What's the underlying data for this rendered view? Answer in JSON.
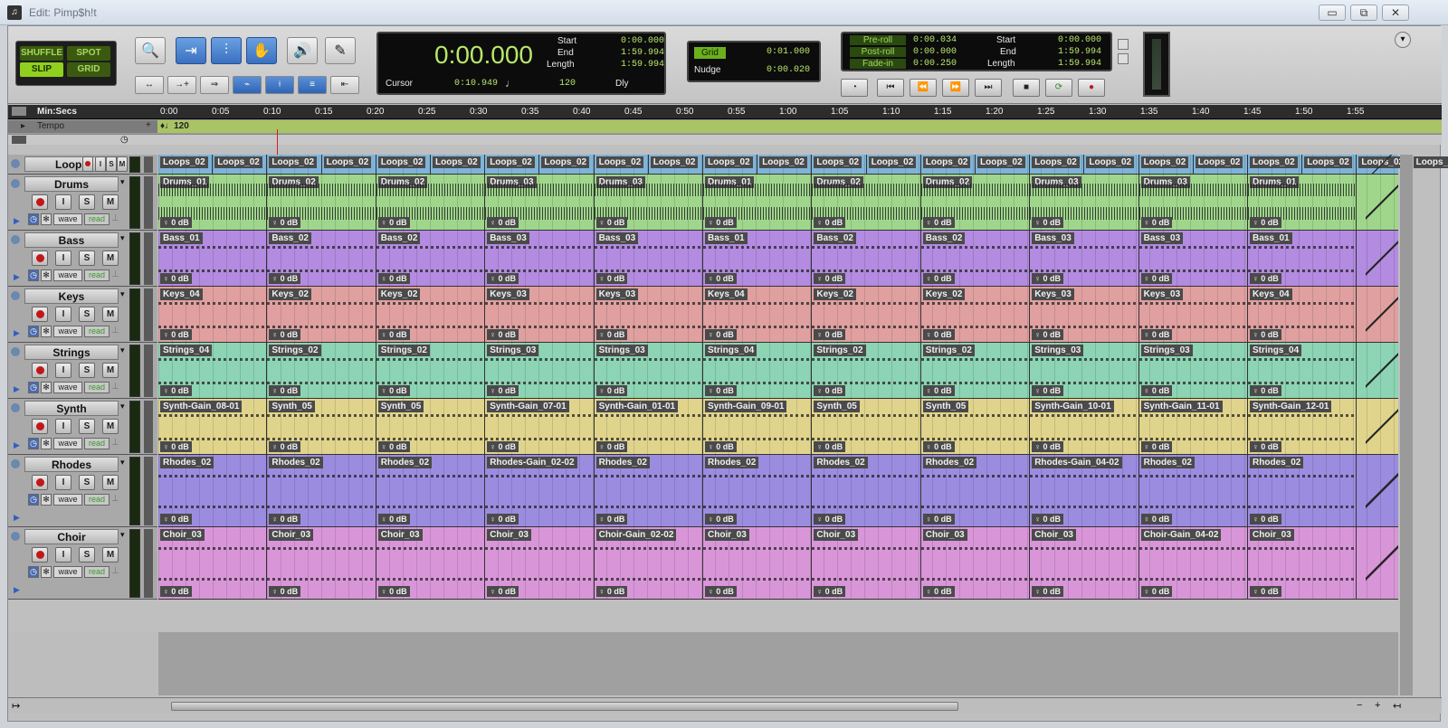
{
  "window": {
    "title": "Edit: Pimp$h!t",
    "buttons": [
      "▭",
      "⧉",
      "✕"
    ]
  },
  "modes": {
    "shuffle": "SHUFFLE",
    "spot": "SPOT",
    "slip": "SLIP",
    "grid": "GRID"
  },
  "main_counter": {
    "value": "0:00.000",
    "start_label": "Start",
    "end_label": "End",
    "length_label": "Length",
    "start": "0:00.000",
    "end": "1:59.994",
    "length": "1:59.994",
    "cursor_label": "Cursor",
    "cursor": "0:10.949",
    "tempo": "120",
    "dly_label": "Dly"
  },
  "grid": {
    "grid_label": "Grid",
    "grid_value": "0:01.000",
    "nudge_label": "Nudge",
    "nudge_value": "0:00.020"
  },
  "transport_counter": {
    "preroll_label": "Pre-roll",
    "postroll_label": "Post-roll",
    "fadein_label": "Fade-in",
    "preroll": "0:00.034",
    "postroll": "0:00.000",
    "fadein": "0:00.250",
    "start_label": "Start",
    "end_label": "End",
    "length_label": "Length",
    "start": "0:00.000",
    "end": "1:59.994",
    "length": "1:59.994"
  },
  "ruler": {
    "label": "Min:Secs",
    "tempo_label": "Tempo",
    "tempo_value": "120",
    "ticks": [
      "0:00",
      "0:05",
      "0:10",
      "0:15",
      "0:20",
      "0:25",
      "0:30",
      "0:35",
      "0:40",
      "0:45",
      "0:50",
      "0:55",
      "1:00",
      "1:05",
      "1:10",
      "1:15",
      "1:20",
      "1:25",
      "1:30",
      "1:35",
      "1:40",
      "1:45",
      "1:50",
      "1:55"
    ]
  },
  "track_buttons": {
    "input": "I",
    "solo": "S",
    "mute": "M",
    "view": "wave",
    "auto": "read"
  },
  "gain_label": "0 dB",
  "tracks": [
    {
      "name": "Loops",
      "color": "#7fb4d8",
      "clips": [
        "Loops_02",
        "Loops_02",
        "Loops_02",
        "Loops_02",
        "Loops_02",
        "Loops_02",
        "Loops_02",
        "Loops_02",
        "Loops_02",
        "Loops_02",
        "Loops_02",
        "Loops_02",
        "Loops_02",
        "Loops_02",
        "Loops_02",
        "Loops_02",
        "Loops_02",
        "Loops_02",
        "Loops_02",
        "Loops_02",
        "Loops_02",
        "Loops_02",
        "Loops_02",
        "Loops_02"
      ]
    },
    {
      "name": "Drums",
      "color": "#9fd68c",
      "clips": [
        "Drums_01",
        "Drums_02",
        "Drums_02",
        "Drums_03",
        "Drums_03",
        "Drums_01",
        "Drums_02",
        "Drums_02",
        "Drums_03",
        "Drums_03",
        "Drums_01"
      ]
    },
    {
      "name": "Bass",
      "color": "#b38be0",
      "clips": [
        "Bass_01",
        "Bass_02",
        "Bass_02",
        "Bass_03",
        "Bass_03",
        "Bass_01",
        "Bass_02",
        "Bass_02",
        "Bass_03",
        "Bass_03",
        "Bass_01"
      ]
    },
    {
      "name": "Keys",
      "color": "#e0a0a0",
      "clips": [
        "Keys_04",
        "Keys_02",
        "Keys_02",
        "Keys_03",
        "Keys_03",
        "Keys_04",
        "Keys_02",
        "Keys_02",
        "Keys_03",
        "Keys_03",
        "Keys_04"
      ]
    },
    {
      "name": "Strings",
      "color": "#8cd4b4",
      "clips": [
        "Strings_04",
        "Strings_02",
        "Strings_02",
        "Strings_03",
        "Strings_03",
        "Strings_04",
        "Strings_02",
        "Strings_02",
        "Strings_03",
        "Strings_03",
        "Strings_04"
      ]
    },
    {
      "name": "Synth",
      "color": "#e0d48c",
      "clips": [
        "Synth-Gain_08-01",
        "Synth_05",
        "Synth_05",
        "Synth-Gain_07-01",
        "Synth-Gain_01-01",
        "Synth-Gain_09-01",
        "Synth_05",
        "Synth_05",
        "Synth-Gain_10-01",
        "Synth-Gain_11-01",
        "Synth-Gain_12-01"
      ]
    },
    {
      "name": "Rhodes",
      "color": "#9c8ce0",
      "clips": [
        "Rhodes_02",
        "Rhodes_02",
        "Rhodes_02",
        "Rhodes-Gain_02-02",
        "Rhodes_02",
        "Rhodes_02",
        "Rhodes_02",
        "Rhodes_02",
        "Rhodes-Gain_04-02",
        "Rhodes_02",
        "Rhodes_02"
      ]
    },
    {
      "name": "Choir",
      "color": "#d896d8",
      "clips": [
        "Choir_03",
        "Choir_03",
        "Choir_03",
        "Choir_03",
        "Choir-Gain_02-02",
        "Choir_03",
        "Choir_03",
        "Choir_03",
        "Choir_03",
        "Choir-Gain_04-02",
        "Choir_03"
      ]
    }
  ]
}
